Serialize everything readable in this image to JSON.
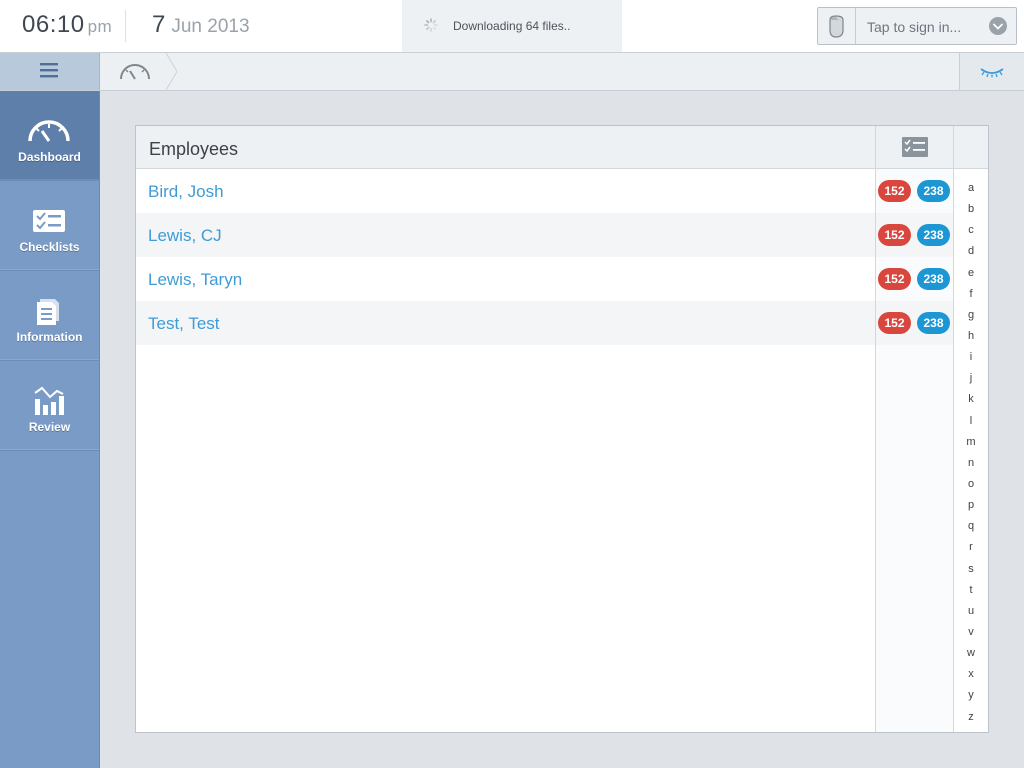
{
  "status": {
    "time": "06:10",
    "ampm": "pm",
    "day": "7",
    "month_year": "Jun 2013",
    "download_text": "Downloading 64 files..",
    "signin_text": "Tap to sign in..."
  },
  "sidebar": {
    "items": [
      {
        "label": "Dashboard",
        "icon": "dashboard-gauge-icon",
        "active": true
      },
      {
        "label": "Checklists",
        "icon": "checklist-icon",
        "active": false
      },
      {
        "label": "Information",
        "icon": "document-icon",
        "active": false
      },
      {
        "label": "Review",
        "icon": "bar-chart-icon",
        "active": false
      }
    ]
  },
  "panel": {
    "title": "Employees",
    "employees": [
      {
        "name": "Bird, Josh",
        "red": "152",
        "blue": "238"
      },
      {
        "name": "Lewis, CJ",
        "red": "152",
        "blue": "238"
      },
      {
        "name": "Lewis, Taryn",
        "red": "152",
        "blue": "238"
      },
      {
        "name": "Test, Test",
        "red": "152",
        "blue": "238"
      }
    ],
    "alphabet": [
      "a",
      "b",
      "c",
      "d",
      "e",
      "f",
      "g",
      "h",
      "i",
      "j",
      "k",
      "l",
      "m",
      "n",
      "o",
      "p",
      "q",
      "r",
      "s",
      "t",
      "u",
      "v",
      "w",
      "x",
      "y",
      "z"
    ]
  },
  "colors": {
    "sidebar": "#7a9bc6",
    "sidebar_active": "#5f7fab",
    "link": "#3f9bd6",
    "badge_red": "#d9463d",
    "badge_blue": "#1d97d4"
  }
}
